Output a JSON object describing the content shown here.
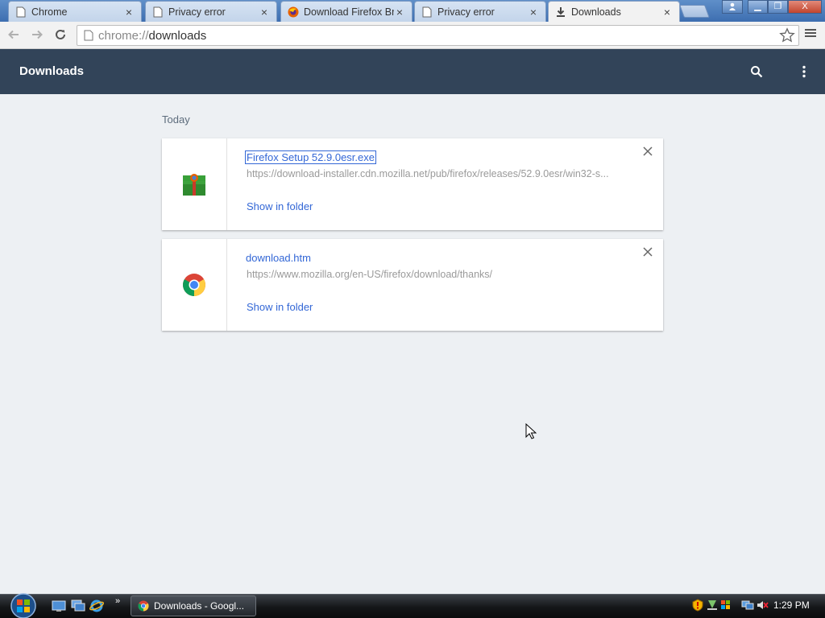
{
  "tabs": [
    {
      "label": "Chrome",
      "icon": "page-icon"
    },
    {
      "label": "Privacy error",
      "icon": "page-icon"
    },
    {
      "label": "Download Firefox Bro",
      "icon": "firefox-icon"
    },
    {
      "label": "Privacy error",
      "icon": "page-icon"
    },
    {
      "label": "Downloads",
      "icon": "download-icon",
      "active": true
    }
  ],
  "window_controls": {
    "minimize": "▁",
    "maximize": "❐",
    "close": "X"
  },
  "toolbar": {
    "url_scheme": "chrome://",
    "url_path": "downloads"
  },
  "downloads_page": {
    "title": "Downloads",
    "section": "Today",
    "items": [
      {
        "file_name": "Firefox Setup 52.9.0esr.exe",
        "url": "https://download-installer.cdn.mozilla.net/pub/firefox/releases/52.9.0esr/win32-s...",
        "action": "Show in folder",
        "icon": "installer-icon"
      },
      {
        "file_name": "download.htm",
        "url": "https://www.mozilla.org/en-US/firefox/download/thanks/",
        "action": "Show in folder",
        "icon": "chrome-icon"
      }
    ]
  },
  "taskbar": {
    "task_label": "Downloads - Googl...",
    "clock": "1:29 PM"
  },
  "colors": {
    "header_bg": "#324459",
    "link_blue": "#3367d6",
    "page_bg": "#edf0f3"
  }
}
